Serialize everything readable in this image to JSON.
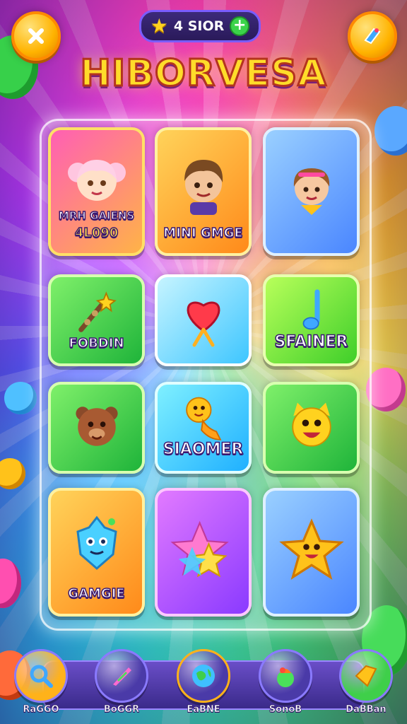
{
  "header": {
    "close_icon": "close-icon",
    "stars_text": "4 SIOR",
    "star_icon": "star-icon",
    "add_icon": "plus-icon",
    "share_icon": "tag-icon",
    "title": "HIBORVESA"
  },
  "tiles": [
    {
      "name": "MRH GAIENS",
      "sub": "4L090",
      "icon": "girl-avatar-icon",
      "color": "pink-orange"
    },
    {
      "name": "MINI GMGE",
      "icon": "boy-avatar-icon",
      "color": "orange"
    },
    {
      "name": "",
      "icon": "kid-avatar-icon",
      "color": "blue"
    },
    {
      "name": "FOBDIN",
      "icon": "wand-icon",
      "color": "green"
    },
    {
      "name": "",
      "icon": "heart-wand-icon",
      "color": "cyan"
    },
    {
      "name": "SFAINER",
      "icon": "music-note-icon",
      "color": "lime"
    },
    {
      "name": "",
      "icon": "bear-icon",
      "color": "green"
    },
    {
      "name": "SIAOMER",
      "icon": "worm-icon",
      "color": "teal"
    },
    {
      "name": "",
      "icon": "cat-face-icon",
      "color": "green"
    },
    {
      "name": "GAMGIE",
      "icon": "robot-icon",
      "color": "orange"
    },
    {
      "name": "",
      "icon": "stars-icon",
      "color": "purple"
    },
    {
      "name": "",
      "icon": "star-face-icon",
      "color": "blue"
    }
  ],
  "nav": [
    {
      "label": "RaGGO",
      "icon": "magnifier-icon"
    },
    {
      "label": "BoGGR",
      "icon": "rocket-icon"
    },
    {
      "label": "EaBNE",
      "icon": "globe-icon"
    },
    {
      "label": "SonoB",
      "icon": "bag-icon"
    },
    {
      "label": "DaBBan",
      "icon": "ticket-icon"
    }
  ]
}
